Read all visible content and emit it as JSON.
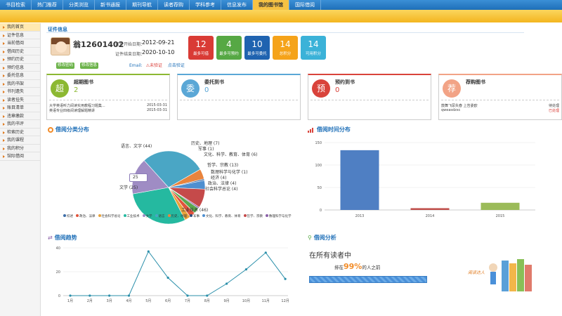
{
  "topnav": [
    "书目检索",
    "热门推荐",
    "分类浏览",
    "新书通报",
    "期刊导航",
    "读者荐购",
    "学科参考",
    "信息发布",
    "我的图书馆",
    "国际借阅"
  ],
  "topnav_active_index": 8,
  "sidebar": [
    "我的首页",
    "证件信息",
    "当前借阅",
    "借阅历史",
    "预约历史",
    "预约信息",
    "委托信息",
    "我的书架",
    "书刊遗失",
    "读者挂失",
    "账目清单",
    "违章缴款",
    "我的书评",
    "检索历史",
    "我的课程",
    "我的积分",
    "馆际借阅"
  ],
  "cert": {
    "title": "证件信息",
    "name": "翁12601402",
    "start_label": "证件开始日期：",
    "start_date": "2012-09-21",
    "end_label": "证件结束日期：",
    "end_date": "2020-10-10",
    "btn_change_pwd": "修改密码",
    "btn_change_info": "修改信息",
    "email_label": "Email:",
    "email_status": "未验证",
    "email_action": "点击验证"
  },
  "tiles": [
    {
      "num": "12",
      "label": "最多可借",
      "color": "#d93b35"
    },
    {
      "num": "4",
      "label": "最多可预约",
      "color": "#56a844"
    },
    {
      "num": "10",
      "label": "最多可委托",
      "color": "#1f63b0"
    },
    {
      "num": "14",
      "label": "总积分",
      "color": "#f5a31a"
    },
    {
      "num": "14",
      "label": "可用积分",
      "color": "#3bb2d8"
    }
  ],
  "cards": [
    {
      "icon": "超",
      "title": "超期图书",
      "value": "2",
      "color": "#8cb832",
      "rows": [
        [
          "大学英语听力阅读实用教程习题集...",
          "2015-03-31"
        ],
        [
          "英语专业四级阅读理解题精讲",
          "2015-03-31"
        ]
      ]
    },
    {
      "icon": "委",
      "title": "委托到书",
      "value": "0",
      "color": "#5aa7d6",
      "rows": []
    },
    {
      "icon": "预",
      "title": "预约到书",
      "value": "0",
      "color": "#d9433b",
      "rows": []
    },
    {
      "icon": "荐",
      "title": "荐购图书",
      "value": "",
      "color": "#f2a386",
      "rows": [
        [
          "鼓舞飞尿失春 上告委欧",
          "待处理"
        ],
        [
          "qweasdzxc",
          "已处理"
        ]
      ]
    }
  ],
  "pie_section": {
    "title": "借阅分类分布"
  },
  "pie_labels": {
    "history": "历史、地理 (7)",
    "military": "军事 (1)",
    "culture": "文化、科学、教育、体育 (6)",
    "philosophy": "哲学、宗教 (13)",
    "math": "数理科学与化学 (1)",
    "economy": "经济 (4)",
    "politics": "政治、法律 (4)",
    "social": "社会科学总论 (4)",
    "language": "语言、文字 (44)",
    "literature": "文学 (25)",
    "industry": "工业技术 (46)",
    "tooltip": "25"
  },
  "legend": [
    "综述",
    "政治、法律",
    "社会科学总论",
    "工业技术",
    "文学",
    "语言",
    "历史、地理",
    "军事",
    "文化、科学、教育、体育",
    "哲学、宗教",
    "数理科学与化学"
  ],
  "chart_data": [
    {
      "type": "pie",
      "title": "借阅分类分布",
      "slices": [
        {
          "name": "工业技术",
          "value": 46,
          "color": "#25b9a0"
        },
        {
          "name": "文学",
          "value": 25,
          "color": "#9f8cc4"
        },
        {
          "name": "语言、文字",
          "value": 44,
          "color": "#4aa6c5"
        },
        {
          "name": "历史、地理",
          "value": 7,
          "color": "#e9843d"
        },
        {
          "name": "军事",
          "value": 1,
          "color": "#3e6ea8"
        },
        {
          "name": "文化、科学、教育、体育",
          "value": 6,
          "color": "#4e8fd0"
        },
        {
          "name": "哲学、宗教",
          "value": 13,
          "color": "#c54a4a"
        },
        {
          "name": "数理科学与化学",
          "value": 1,
          "color": "#8a5fa8"
        },
        {
          "name": "经济",
          "value": 4,
          "color": "#5aa84e"
        },
        {
          "name": "政治、法律",
          "value": 4,
          "color": "#e0533b"
        },
        {
          "name": "社会科学总论",
          "value": 4,
          "color": "#e8a23b"
        }
      ]
    },
    {
      "type": "bar",
      "title": "借阅时间分布",
      "categories": [
        "2013",
        "2014",
        "2015"
      ],
      "values": [
        133,
        4,
        16
      ],
      "colors": [
        "#4f7fc3",
        "#c0504d",
        "#9bbb59"
      ],
      "yticks": [
        0,
        50,
        100,
        150
      ],
      "ylim": [
        0,
        150
      ]
    },
    {
      "type": "line",
      "title": "借阅趋势",
      "categories": [
        "1月",
        "2月",
        "3月",
        "4月",
        "5月",
        "6月",
        "7月",
        "8月",
        "9月",
        "10月",
        "11月",
        "12月"
      ],
      "values": [
        0,
        0,
        0,
        0,
        37,
        15,
        0,
        0,
        10,
        22,
        36,
        14
      ],
      "yticks": [
        0,
        20,
        40
      ],
      "ylim": [
        0,
        40
      ],
      "color": "#2a8faa"
    }
  ],
  "bar_section": {
    "title": "借阅时间分布"
  },
  "trend_section": {
    "title": "借阅趋势"
  },
  "analysis": {
    "title": "借阅分析",
    "heading": "在所有读者中",
    "rank_prefix": "排在",
    "rank_value": "99%",
    "rank_suffix": "的人之前",
    "progress": 0.99,
    "illustration_text": "阅读达人"
  }
}
